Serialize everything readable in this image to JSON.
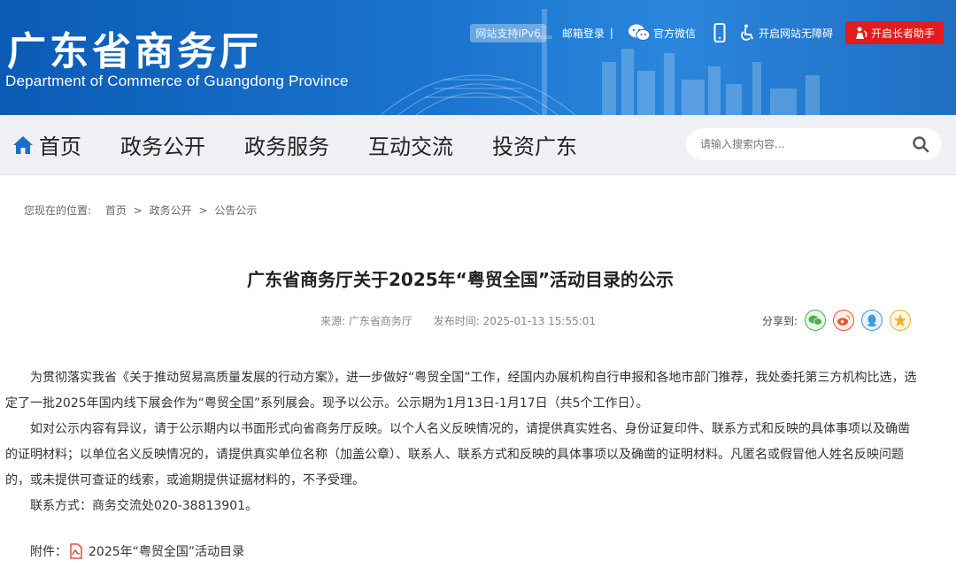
{
  "header": {
    "title_cn": "广东省商务厅",
    "title_en": "Department of Commerce of Guangdong Province",
    "ipv6_label": "网站支持IPv6",
    "mail_login": "邮箱登录",
    "separator": "|",
    "wechat_label": "官方微信",
    "accessibility_label": "开启网站无障碍",
    "elder_label": "开启长者助手"
  },
  "nav": {
    "items": [
      "首页",
      "政务公开",
      "政务服务",
      "互动交流",
      "投资广东"
    ],
    "search_placeholder": "请输入搜索内容..."
  },
  "breadcrumb": {
    "prefix": "您现在的位置:",
    "path": [
      "首页",
      "政务公开",
      "公告公示"
    ],
    "sep": ">"
  },
  "article": {
    "title": "广东省商务厅关于2025年“粤贸全国”活动目录的公示",
    "source_label": "来源:",
    "source": "广东省商务厅",
    "publish_label": "发布时间:",
    "publish_time": "2025-01-13 15:55:01",
    "share_label": "分享到:",
    "paragraphs": [
      "为贯彻落实我省《关于推动贸易高质量发展的行动方案》，进一步做好“粤贸全国”工作，经国内办展机构自行申报和各地市部门推荐，我处委托第三方机构比选，选定了一批2025年国内线下展会作为“粤贸全国”系列展会。现予以公示。公示期为1月13日-1月17日（共5个工作日）。",
      "如对公示内容有异议，请于公示期内以书面形式向省商务厅反映。以个人名义反映情况的，请提供真实姓名、身份证复印件、联系方式和反映的具体事项以及确凿的证明材料；以单位名义反映情况的，请提供真实单位名称（加盖公章）、联系人、联系方式和反映的具体事项以及确凿的证明材料。凡匿名或假冒他人姓名反映问题的，或未提供可查证的线索，或逾期提供证据材料的，不予受理。",
      "联系方式：商务交流处020-38813901。"
    ],
    "attachment_label": "附件：",
    "attachment_name": "2025年“粤贸全国”活动目录"
  },
  "colors": {
    "banner": "#1a74cf",
    "elder_button": "#e31b1b",
    "nav_bg": "#eef0f3",
    "home_icon": "#1a6fc9"
  }
}
